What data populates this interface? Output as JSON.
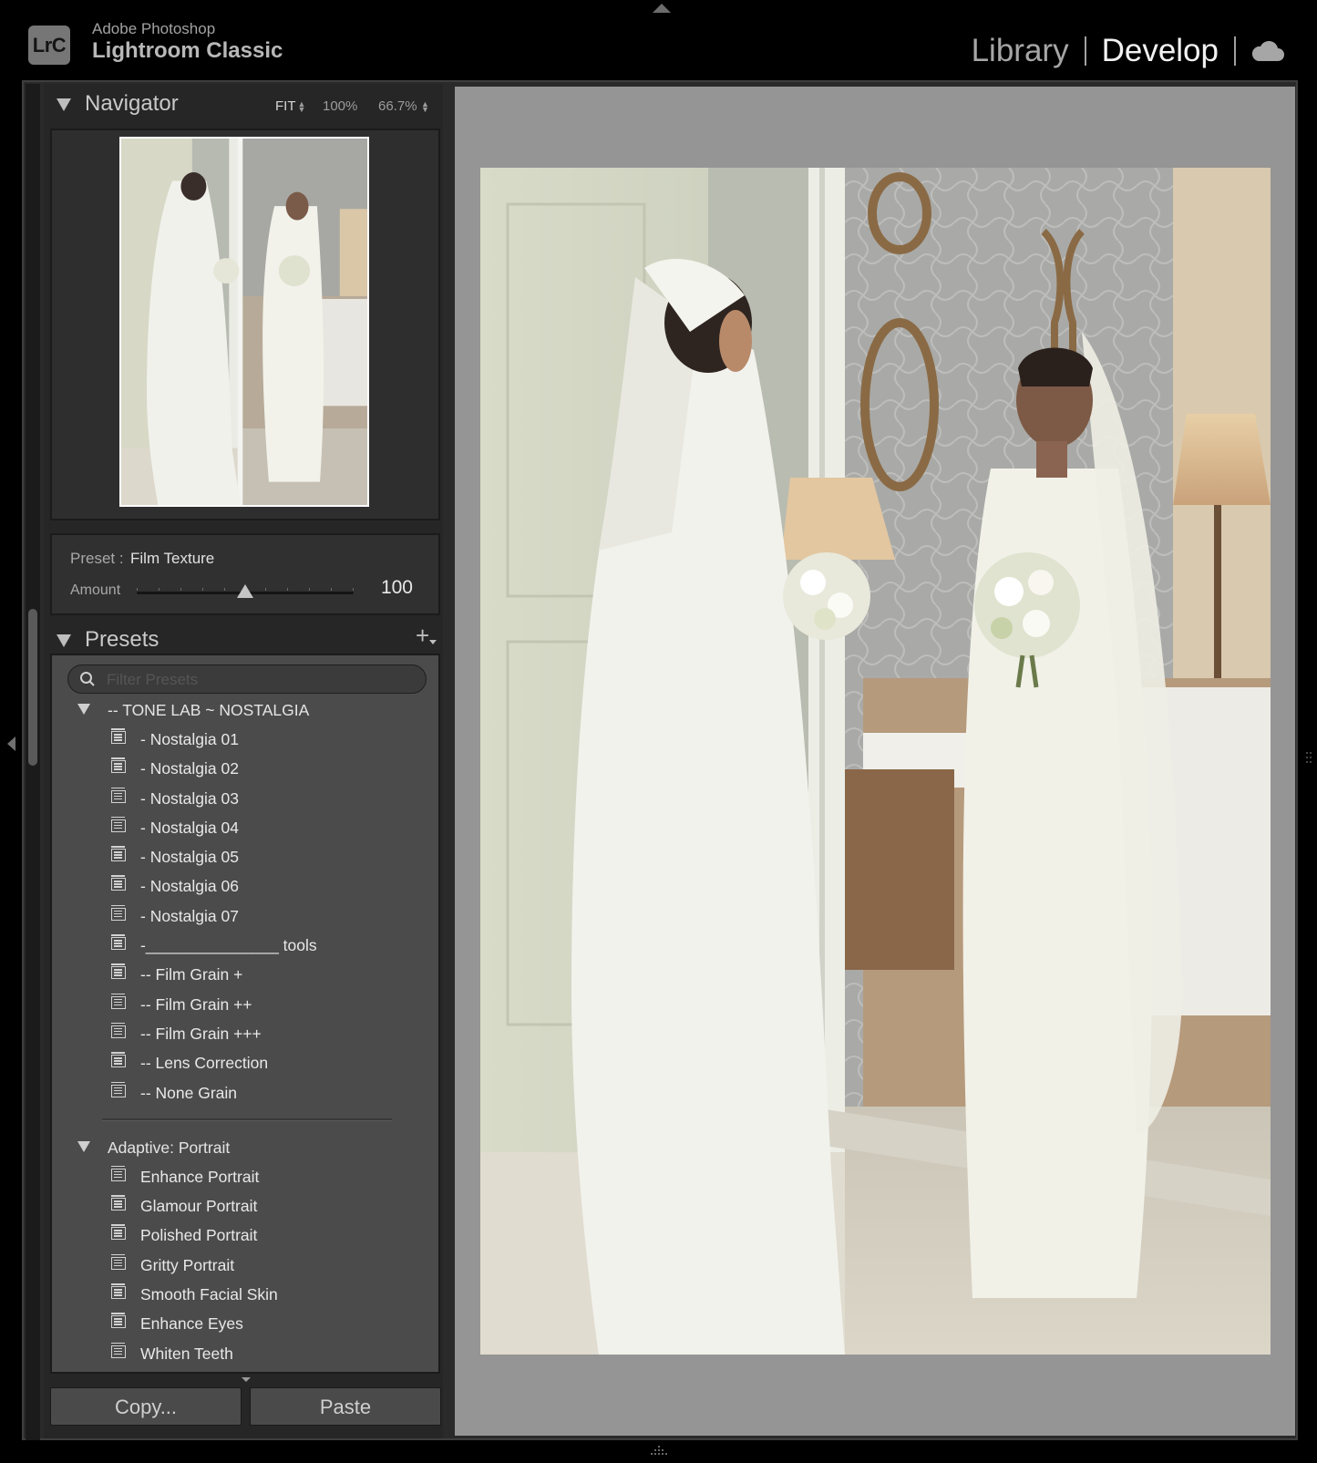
{
  "app": {
    "vendor": "Adobe Photoshop",
    "name": "Lightroom Classic",
    "logo_text": "LrC"
  },
  "modules": {
    "library": "Library",
    "develop": "Develop",
    "active": "Develop",
    "cloud_icon": "cloud-icon"
  },
  "navigator": {
    "title": "Navigator",
    "zoom_fit": "FIT",
    "zoom_100": "100%",
    "zoom_custom": "66.7%"
  },
  "preset_amount": {
    "preset_label": "Preset :",
    "preset_name": "Film Texture",
    "amount_label": "Amount",
    "amount_value": "100",
    "slider_fraction": 0.5
  },
  "presets": {
    "title": "Presets",
    "add_label": "+",
    "filter_placeholder": "Filter Presets",
    "groups": [
      {
        "label": "-- TONE LAB ~ NOSTALGIA",
        "items": [
          "- Nostalgia 01",
          "- Nostalgia 02",
          "- Nostalgia 03",
          "- Nostalgia 04",
          "- Nostalgia 05",
          "- Nostalgia 06",
          "- Nostalgia 07",
          "-_______________ tools",
          "-- Film Grain +",
          "-- Film Grain ++",
          "-- Film Grain +++",
          "-- Lens Correction",
          "-- None Grain"
        ]
      },
      {
        "label": "Adaptive: Portrait",
        "items": [
          "Enhance Portrait",
          "Glamour Portrait",
          "Polished Portrait",
          "Gritty Portrait",
          "Smooth Facial Skin",
          "Enhance Eyes",
          "Whiten Teeth"
        ]
      }
    ]
  },
  "buttons": {
    "copy": "Copy...",
    "paste": "Paste"
  },
  "colors": {
    "background": "#000000",
    "panel": "#262626",
    "preset_list_bg": "#4b4b4b",
    "main_view_bg": "#959595",
    "active_module": "#f2f2f2"
  }
}
